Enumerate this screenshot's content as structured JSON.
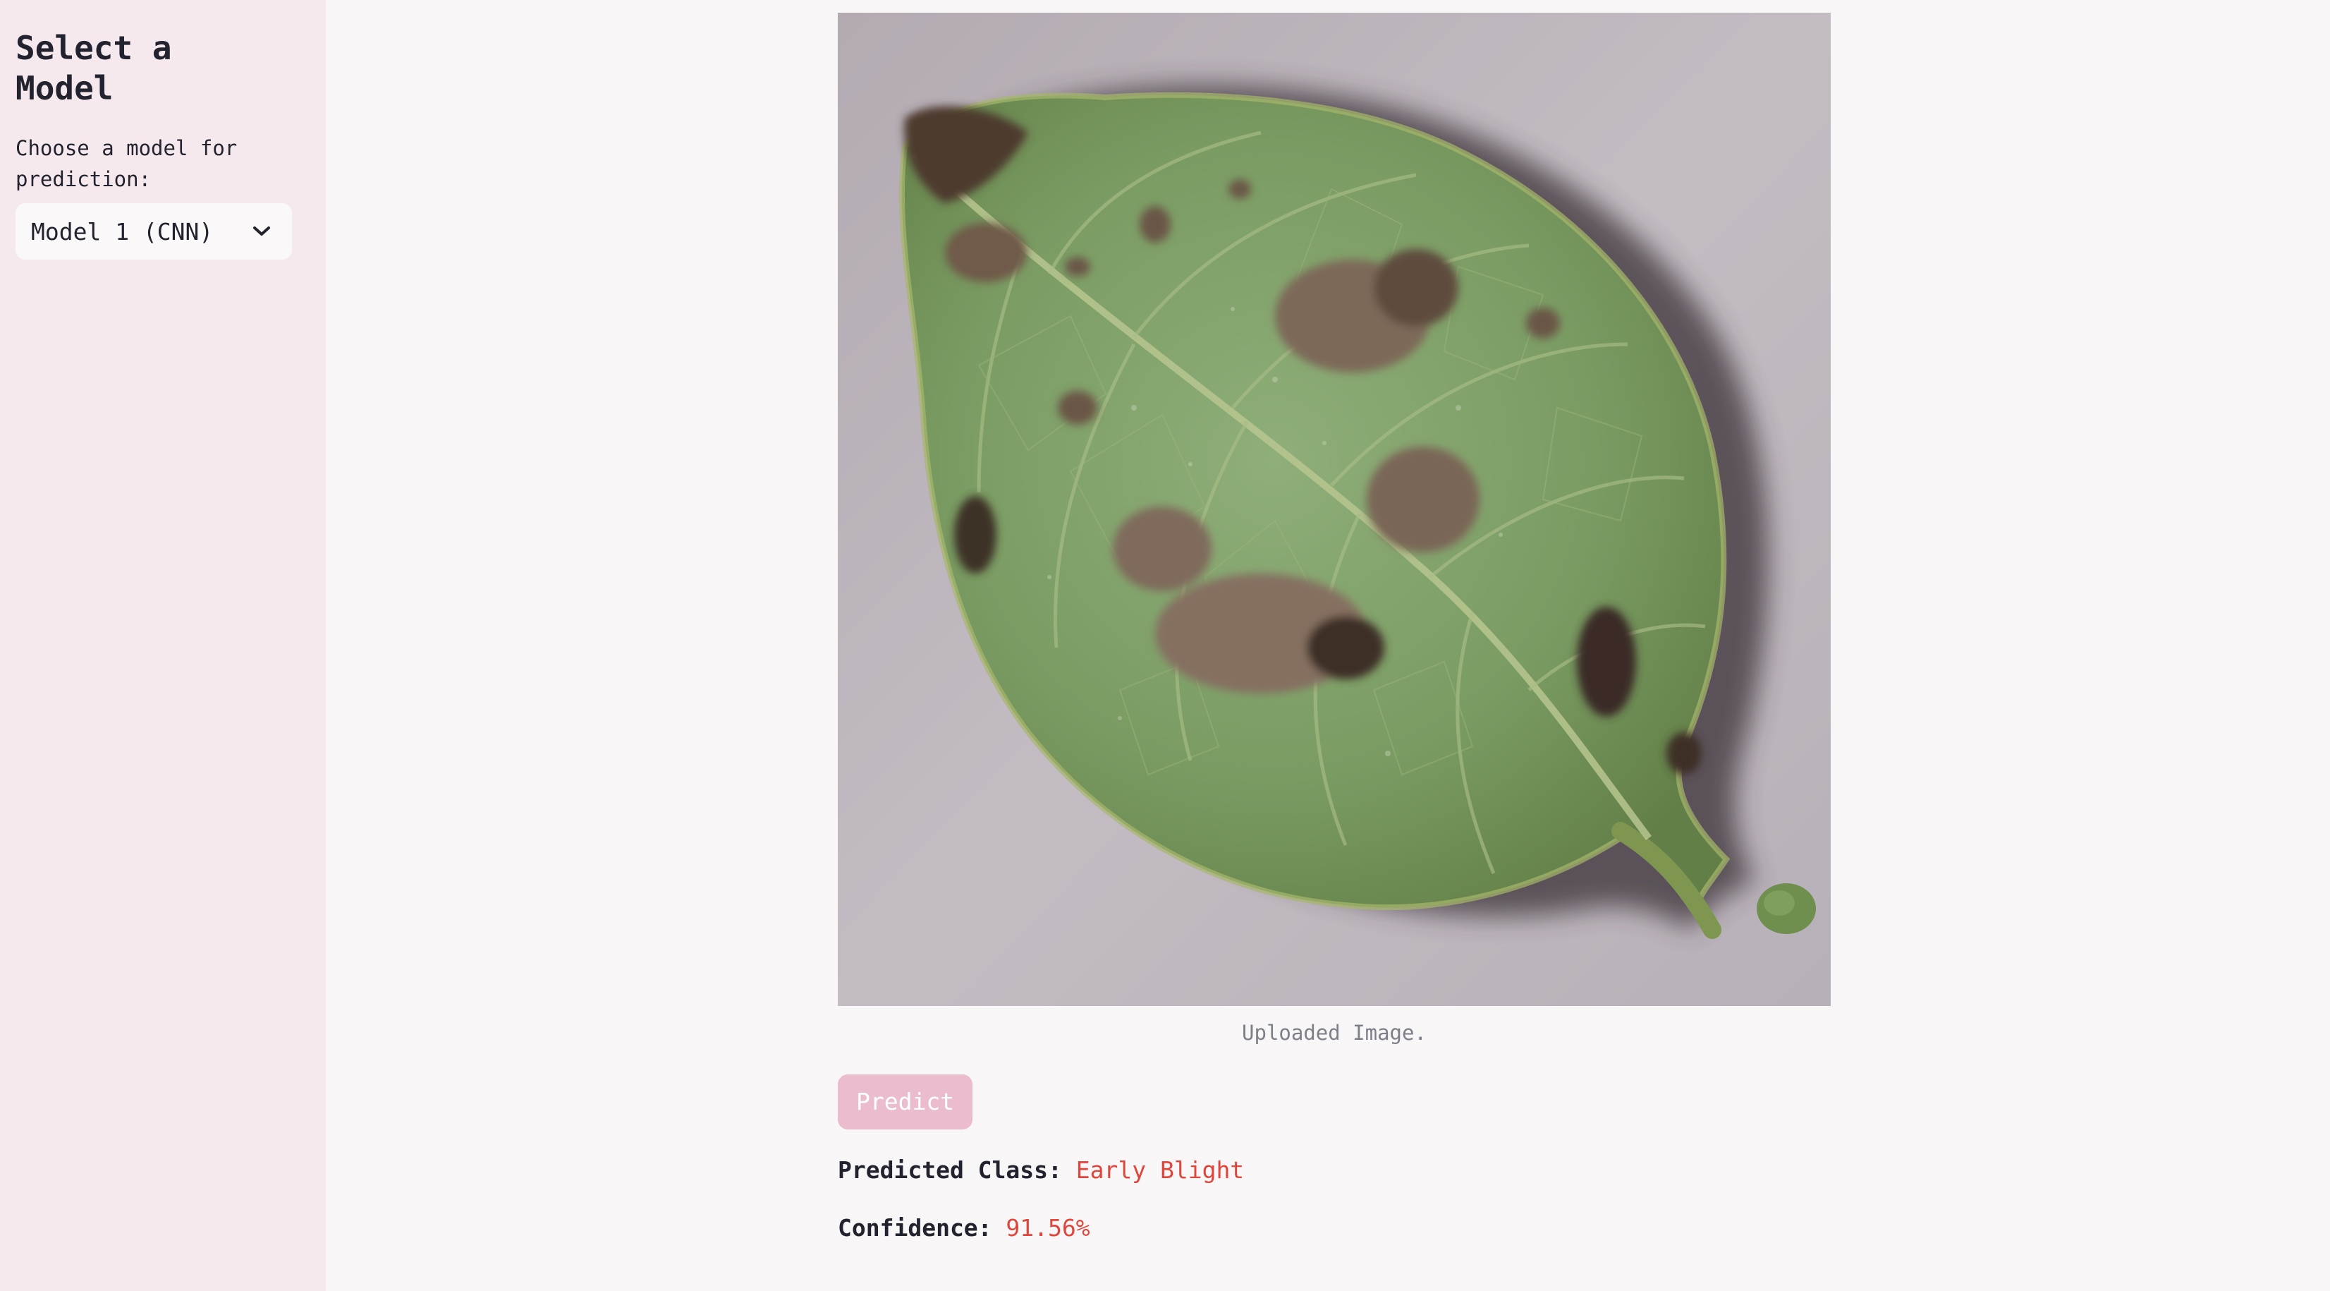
{
  "sidebar": {
    "title": "Select a Model",
    "model_label": "Choose a model for prediction:",
    "model_select": {
      "selected": "Model 1 (CNN)",
      "icon": "chevron-down-icon"
    }
  },
  "main": {
    "image_caption": "Uploaded Image.",
    "predict_label": "Predict",
    "result": {
      "class_label": "Predicted Class:",
      "class_value": "Early Blight",
      "confidence_label": "Confidence:",
      "confidence_value": "91.56%"
    }
  },
  "colors": {
    "sidebar_bg": "#f6e9ee",
    "main_bg": "#f8f6f7",
    "button_bg": "#ebbccd",
    "value_accent": "#e0453c"
  }
}
